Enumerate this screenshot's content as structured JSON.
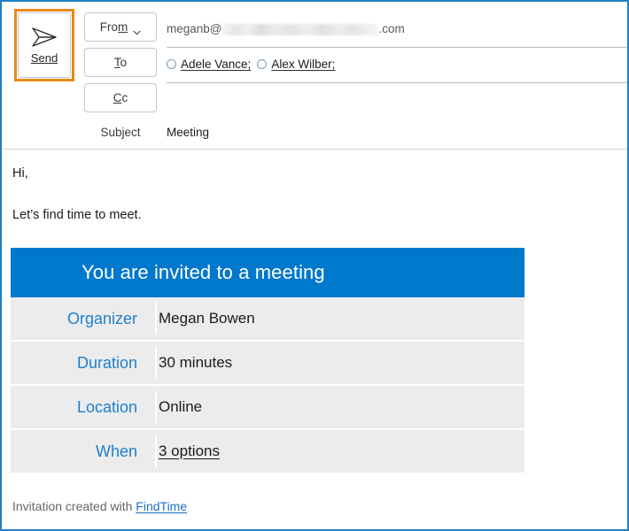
{
  "window": {
    "border_color": "#2081C7",
    "focus_highlight_color": "#E88A14"
  },
  "compose": {
    "send_button": {
      "label": "Send",
      "icon": "paper-plane-icon",
      "focused": "true"
    },
    "field_buttons": [
      {
        "id": "from",
        "label_before": "Fro",
        "label_key": "m",
        "label_after": "",
        "has_chevron": "true"
      },
      {
        "id": "to",
        "label_before": "",
        "label_key": "T",
        "label_after": "o",
        "has_chevron": "false"
      },
      {
        "id": "cc",
        "label_before": "",
        "label_key": "C",
        "label_after": "c",
        "has_chevron": "false"
      }
    ],
    "from": {
      "prefix": "meganb@",
      "redacted": "true",
      "suffix": ".com"
    },
    "to": {
      "recipients": [
        {
          "name": "Adele Vance;",
          "presence": "unknown"
        },
        {
          "name": "Alex Wilber;",
          "presence": "unknown"
        }
      ]
    },
    "cc": {
      "recipients": []
    },
    "subject": {
      "label_before": "S",
      "label_key": "u",
      "label_after": "bject",
      "value": "Meeting"
    }
  },
  "body": {
    "greeting": "Hi,",
    "intro": "Let’s find time to meet.",
    "card": {
      "banner": "You are invited to a meeting",
      "banner_color": "#0078CC",
      "row_bg_color": "#ECECEC",
      "label_color": "#1F7FCC",
      "rows": [
        {
          "label": "Organizer",
          "value": "Megan Bowen",
          "is_link": "false"
        },
        {
          "label": "Duration",
          "value": "30 minutes",
          "is_link": "false"
        },
        {
          "label": "Location",
          "value": "Online",
          "is_link": "false"
        },
        {
          "label": "When",
          "value": "3 options",
          "is_link": "true"
        }
      ]
    },
    "footer": {
      "text": "Invitation created with ",
      "link": "FindTime"
    }
  }
}
